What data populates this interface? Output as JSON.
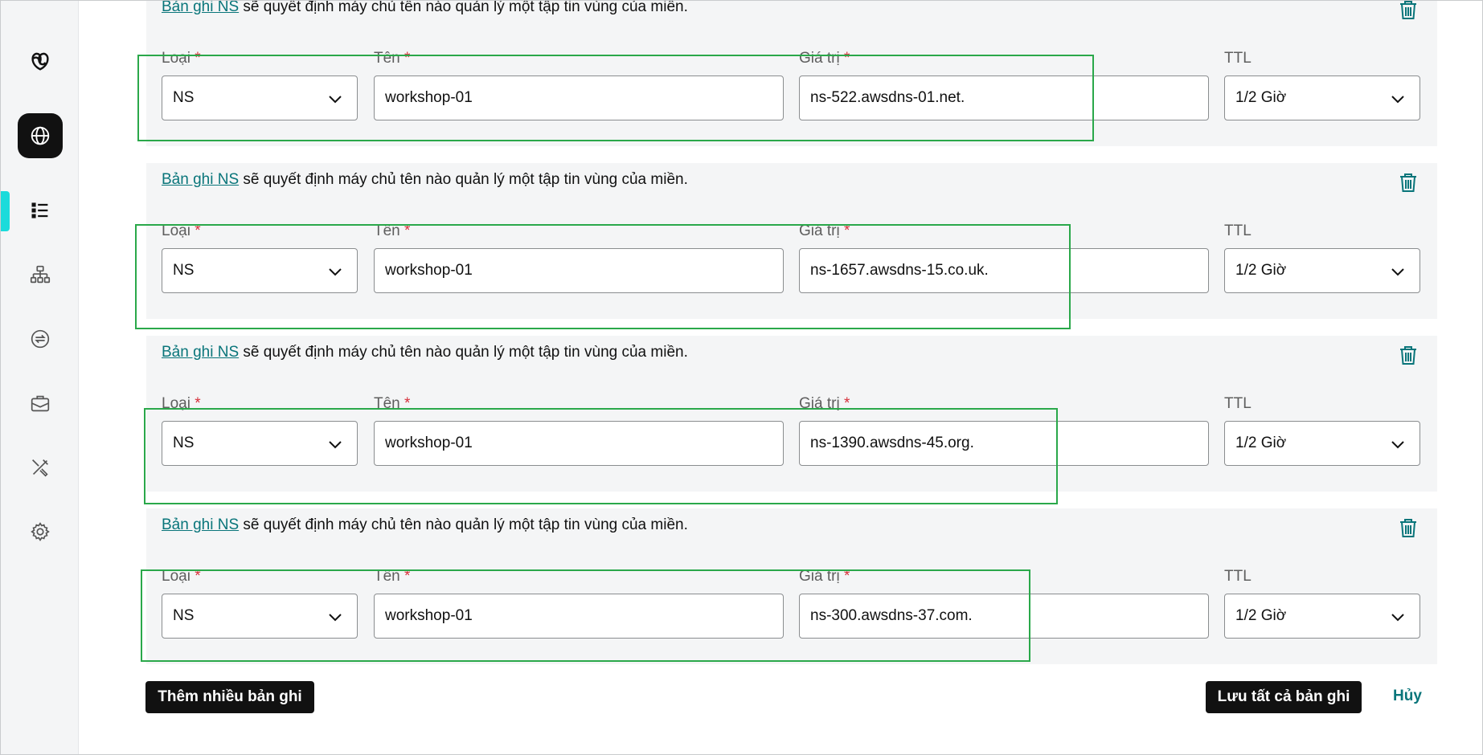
{
  "sidebar": {
    "items": [
      {
        "name": "godaddy-logo-icon"
      },
      {
        "name": "globe-icon"
      },
      {
        "name": "list-icon"
      },
      {
        "name": "sitemap-icon"
      },
      {
        "name": "transfer-icon"
      },
      {
        "name": "briefcase-icon"
      },
      {
        "name": "tools-icon"
      },
      {
        "name": "gear-icon"
      }
    ]
  },
  "labels": {
    "type": "Loại",
    "name": "Tên",
    "value": "Giá trị",
    "ttl": "TTL",
    "required_mark": "*"
  },
  "records": [
    {
      "desc_link": "Bản ghi NS",
      "desc_text": " sẽ quyết định máy chủ tên nào quản lý một tập tin vùng của miền.",
      "type": "NS",
      "name": "workshop-01",
      "value": "ns-522.awsdns-01.net.",
      "ttl": "1/2 Giờ"
    },
    {
      "desc_link": "Bản ghi NS",
      "desc_text": " sẽ quyết định máy chủ tên nào quản lý một tập tin vùng của miền.",
      "type": "NS",
      "name": "workshop-01",
      "value": "ns-1657.awsdns-15.co.uk.",
      "ttl": "1/2 Giờ"
    },
    {
      "desc_link": "Bản ghi NS",
      "desc_text": " sẽ quyết định máy chủ tên nào quản lý một tập tin vùng của miền.",
      "type": "NS",
      "name": "workshop-01",
      "value": "ns-1390.awsdns-45.org.",
      "ttl": "1/2 Giờ"
    },
    {
      "desc_link": "Bản ghi NS",
      "desc_text": " sẽ quyết định máy chủ tên nào quản lý một tập tin vùng của miền.",
      "type": "NS",
      "name": "workshop-01",
      "value": "ns-300.awsdns-37.com.",
      "ttl": "1/2 Giờ"
    }
  ],
  "actions": {
    "add_more": "Thêm nhiều bản ghi",
    "save_all": "Lưu tất cả bản ghi",
    "cancel": "Hủy"
  },
  "colors": {
    "link": "#09757a",
    "highlight": "#2aa84a",
    "required": "#d6303a",
    "active_indicator": "#1bdbdb"
  }
}
